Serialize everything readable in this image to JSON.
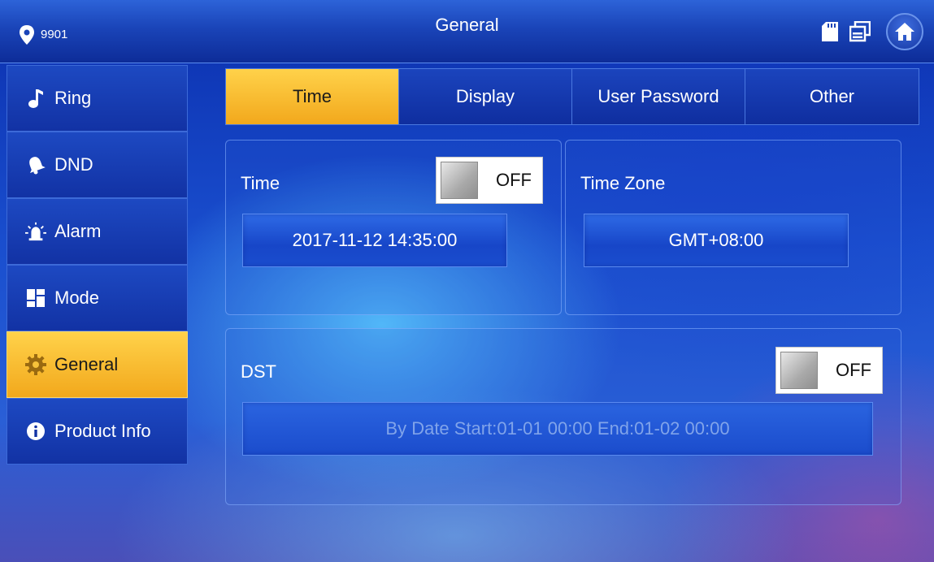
{
  "header": {
    "location_icon": "map-pin-icon",
    "location_text": "9901",
    "title": "General",
    "icons": [
      "sd-card-icon",
      "windows-icon",
      "home-icon"
    ]
  },
  "sidebar": {
    "items": [
      {
        "label": "Ring",
        "icon": "music-note-icon",
        "active": false
      },
      {
        "label": "DND",
        "icon": "bell-icon",
        "active": false
      },
      {
        "label": "Alarm",
        "icon": "alarm-light-icon",
        "active": false
      },
      {
        "label": "Mode",
        "icon": "grid-icon",
        "active": false
      },
      {
        "label": "General",
        "icon": "gear-icon",
        "active": true
      },
      {
        "label": "Product Info",
        "icon": "info-icon",
        "active": false
      }
    ]
  },
  "tabs": [
    {
      "label": "Time",
      "active": true
    },
    {
      "label": "Display",
      "active": false
    },
    {
      "label": "User Password",
      "active": false
    },
    {
      "label": "Other",
      "active": false
    }
  ],
  "time_panel": {
    "label": "Time",
    "toggle_state": "OFF",
    "value": "2017-11-12 14:35:00"
  },
  "timezone_panel": {
    "label": "Time Zone",
    "value": "GMT+08:00"
  },
  "dst_panel": {
    "label": "DST",
    "toggle_state": "OFF",
    "value": "By Date Start:01-01 00:00  End:01-02 00:00"
  },
  "colors": {
    "accent_active": "#f7b928",
    "background": "#1a4fcf",
    "header": "#1a44b8"
  }
}
